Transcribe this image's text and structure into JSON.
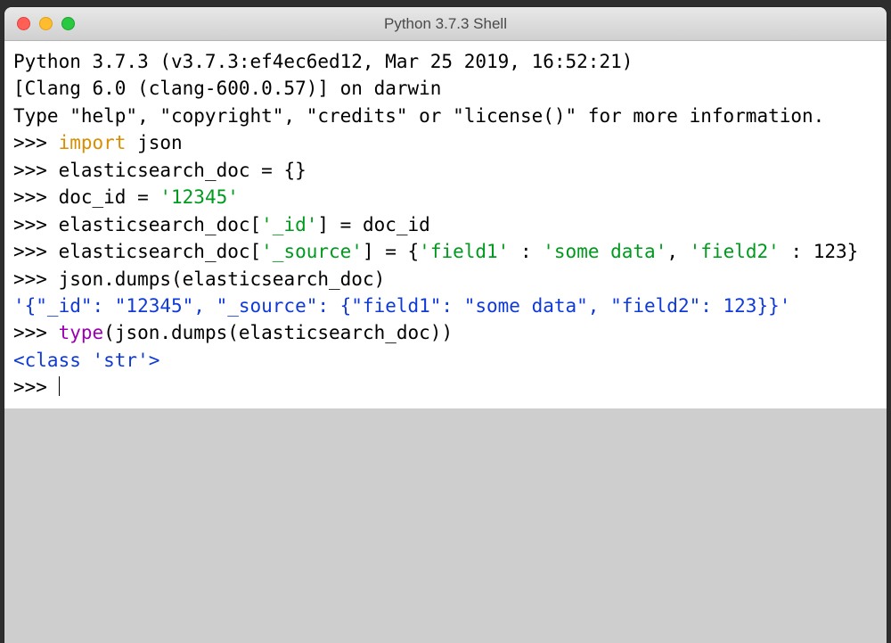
{
  "window": {
    "title": "Python 3.7.3 Shell"
  },
  "header": {
    "line1": "Python 3.7.3 (v3.7.3:ef4ec6ed12, Mar 25 2019, 16:52:21)",
    "line2": "[Clang 6.0 (clang-600.0.57)] on darwin",
    "line3": "Type \"help\", \"copyright\", \"credits\" or \"license()\" for more information."
  },
  "prompt": ">>> ",
  "lines": {
    "l1": {
      "kw": "import",
      "rest": " json"
    },
    "l2": "elasticsearch_doc = {}",
    "l3": {
      "a": "doc_id = ",
      "s": "'12345'"
    },
    "l4": {
      "a": "elasticsearch_doc[",
      "s1": "'_id'",
      "b": "] = doc_id"
    },
    "l5": {
      "a": "elasticsearch_doc[",
      "s1": "'_source'",
      "b": "] = {",
      "s2": "'field1'",
      "c": " : ",
      "s3": "'some data'",
      "d": ", ",
      "s4": "'field2'",
      "e": " : 123}"
    },
    "l6": "json.dumps(elasticsearch_doc)",
    "out1": "'{\"_id\": \"12345\", \"_source\": {\"field1\": \"some data\", \"field2\": 123}}'",
    "l7": {
      "fn": "type",
      "args": "(json.dumps(elasticsearch_doc))"
    },
    "out2": "<class 'str'>"
  }
}
